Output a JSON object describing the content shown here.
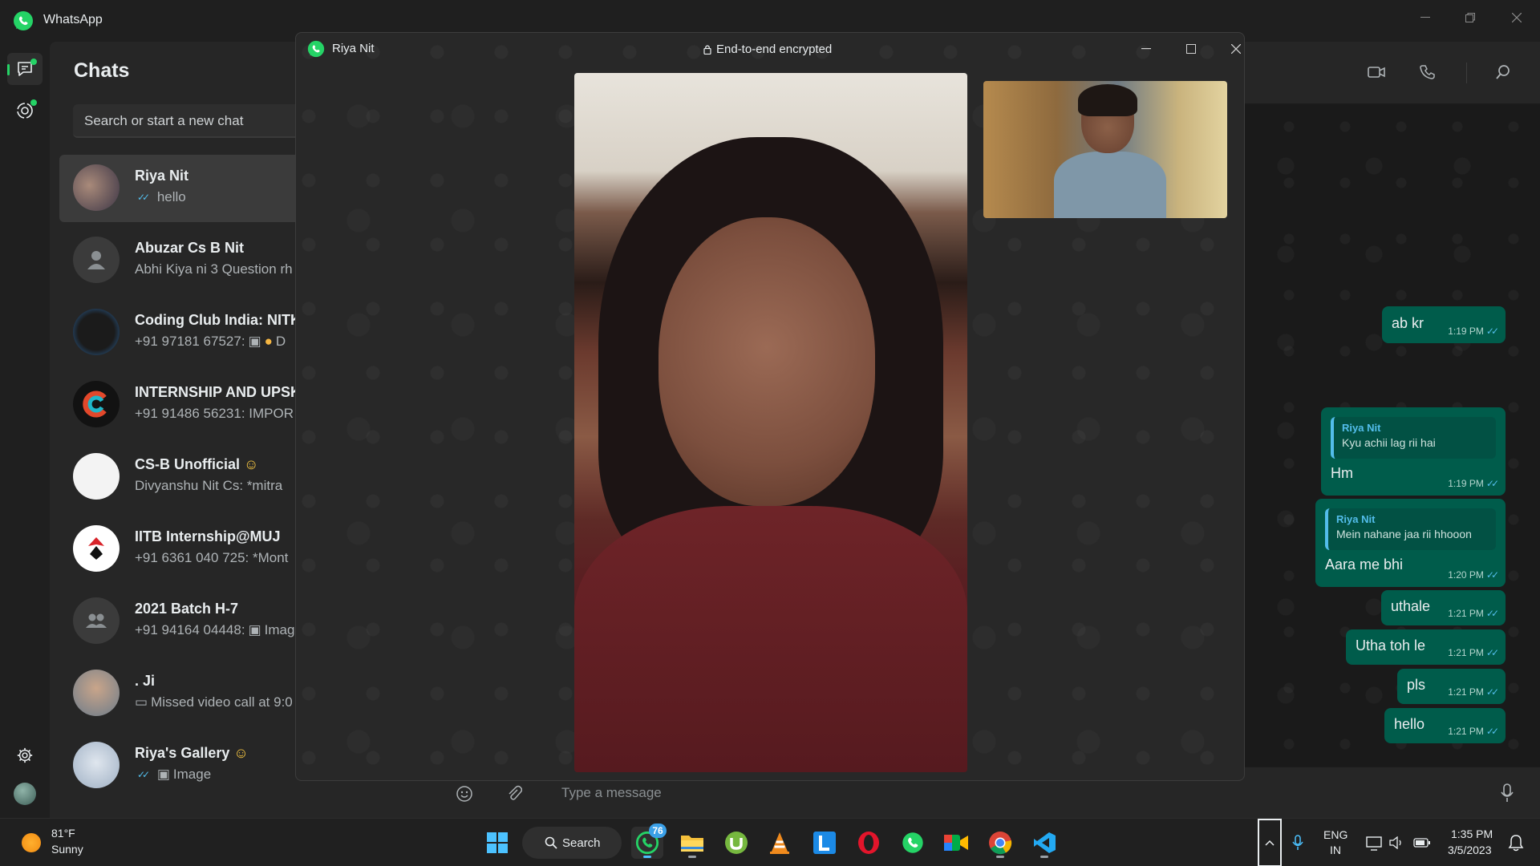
{
  "app": {
    "title": "WhatsApp"
  },
  "sidebar": {
    "heading": "Chats",
    "search_placeholder": "Search or start a new chat",
    "chats": [
      {
        "name": "Riya Nit",
        "preview": "hello",
        "read_ticks": true,
        "selected": true
      },
      {
        "name": "Abuzar Cs B Nit",
        "preview": "Abhi Kiya ni 3 Question rh"
      },
      {
        "name": "Coding Club India: NITK,A",
        "preview": "+91 97181 67527:",
        "trailing": "D"
      },
      {
        "name": "INTERNSHIP AND UPSKIL",
        "preview": "+91 91486 56231: IMPOR"
      },
      {
        "name": "CS-B Unofficial",
        "preview": "Divyanshu Nit Cs: *mitra"
      },
      {
        "name": "IITB Internship@MUJ",
        "preview": "+91 6361 040 725: *Mont"
      },
      {
        "name": "2021 Batch H-7",
        "preview": "+91 94164 04448:",
        "trailing": "Imag"
      },
      {
        "name": ". Ji",
        "preview": "Missed video call at 9:0"
      },
      {
        "name": "Riya's Gallery",
        "preview": "Image",
        "read_ticks": true
      }
    ]
  },
  "conversation": {
    "composer_placeholder": "Type a message",
    "messages": [
      {
        "text": "ab kr",
        "time": "1:19 PM"
      },
      {
        "text": "Hm",
        "time": "1:19 PM",
        "quote_author": "Riya Nit",
        "quote_text": "Kyu achii lag rii hai"
      },
      {
        "text": "Aara me bhi",
        "time": "1:20 PM",
        "quote_author": "Riya Nit",
        "quote_text": "Mein nahane jaa rii hhooon"
      },
      {
        "text": "uthale",
        "time": "1:21 PM"
      },
      {
        "text": "Utha toh le",
        "time": "1:21 PM"
      },
      {
        "text": "pls",
        "time": "1:21 PM"
      },
      {
        "text": "hello",
        "time": "1:21 PM"
      }
    ]
  },
  "call_window": {
    "contact_name": "Riya Nit",
    "encryption_label": "End-to-end encrypted"
  },
  "taskbar": {
    "weather_temp": "81°F",
    "weather_condition": "Sunny",
    "search_label": "Search",
    "whatsapp_badge": "76",
    "language_line1": "ENG",
    "language_line2": "IN",
    "time": "1:35 PM",
    "date": "3/5/2023"
  },
  "colors": {
    "accent": "#25d366",
    "outgoing_bubble": "#005c4b",
    "read_ticks": "#53bdeb"
  }
}
